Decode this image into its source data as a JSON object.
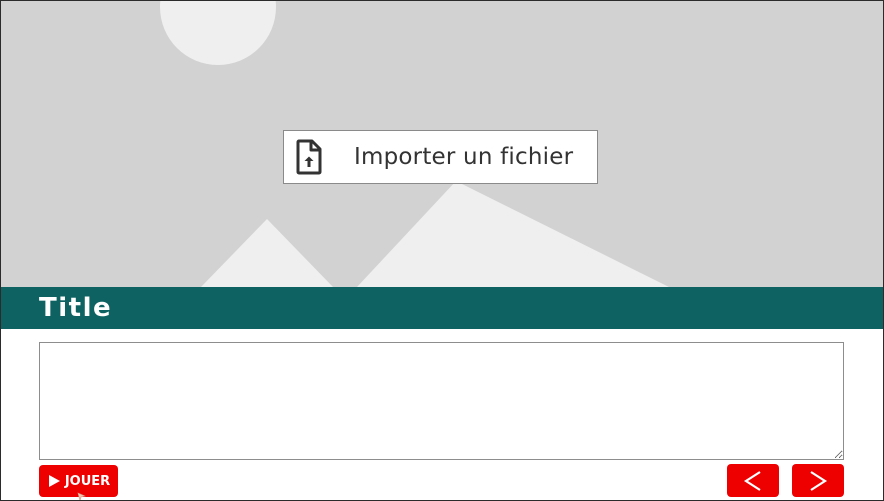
{
  "hero": {
    "import_label": "Importer un fichier",
    "colors": {
      "background": "#d2d2d2",
      "shapes": "#efefef"
    }
  },
  "title_bar": {
    "title": "Title",
    "color": "#0e6262"
  },
  "text_area": {
    "value": ""
  },
  "controls": {
    "play_label": "JOUER",
    "prev_icon": "chevron-left-icon",
    "next_icon": "chevron-right-icon",
    "accent_color": "#ee0000"
  }
}
